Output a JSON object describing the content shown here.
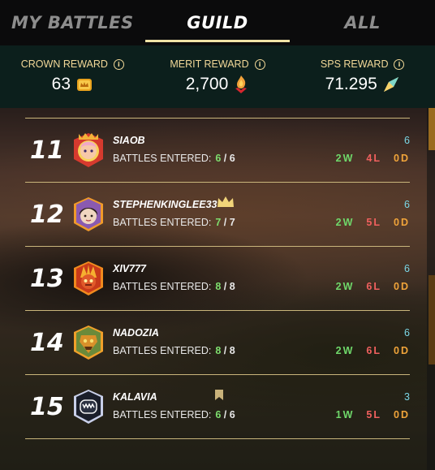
{
  "tabs": [
    {
      "label": "MY BATTLES",
      "active": false
    },
    {
      "label": "GUILD",
      "active": true
    },
    {
      "label": "ALL",
      "active": false
    }
  ],
  "rewards": [
    {
      "label": "CROWN REWARD",
      "value": "63",
      "icon": "crown-token-icon"
    },
    {
      "label": "MERIT REWARD",
      "value": "2,700",
      "icon": "merit-flame-icon"
    },
    {
      "label": "SPS REWARD",
      "value": "71.295",
      "icon": "sps-crystal-icon"
    }
  ],
  "battles_label": "BATTLES ENTERED:",
  "players": [
    {
      "rank": "11",
      "name": "SIAOB",
      "entered": "6",
      "total": "6",
      "score": "6",
      "wins": "2W",
      "losses": "4L",
      "draws": "0D",
      "badge": ""
    },
    {
      "rank": "12",
      "name": "STEPHENKINGLEE33",
      "entered": "7",
      "total": "7",
      "score": "6",
      "wins": "2W",
      "losses": "5L",
      "draws": "0D",
      "badge": "crown-icon"
    },
    {
      "rank": "13",
      "name": "XIV777",
      "entered": "8",
      "total": "8",
      "score": "6",
      "wins": "2W",
      "losses": "6L",
      "draws": "0D",
      "badge": ""
    },
    {
      "rank": "14",
      "name": "NADOZIA",
      "entered": "8",
      "total": "8",
      "score": "6",
      "wins": "2W",
      "losses": "6L",
      "draws": "0D",
      "badge": ""
    },
    {
      "rank": "15",
      "name": "KALAVIA",
      "entered": "6",
      "total": "6",
      "score": "3",
      "wins": "1W",
      "losses": "5L",
      "draws": "0D",
      "badge": "bookmark-icon"
    }
  ],
  "colors": {
    "accent": "#f1e3a6",
    "win": "#6fd86a",
    "loss": "#f0605e",
    "draw": "#f0a43a",
    "score": "#7ad7e6"
  }
}
